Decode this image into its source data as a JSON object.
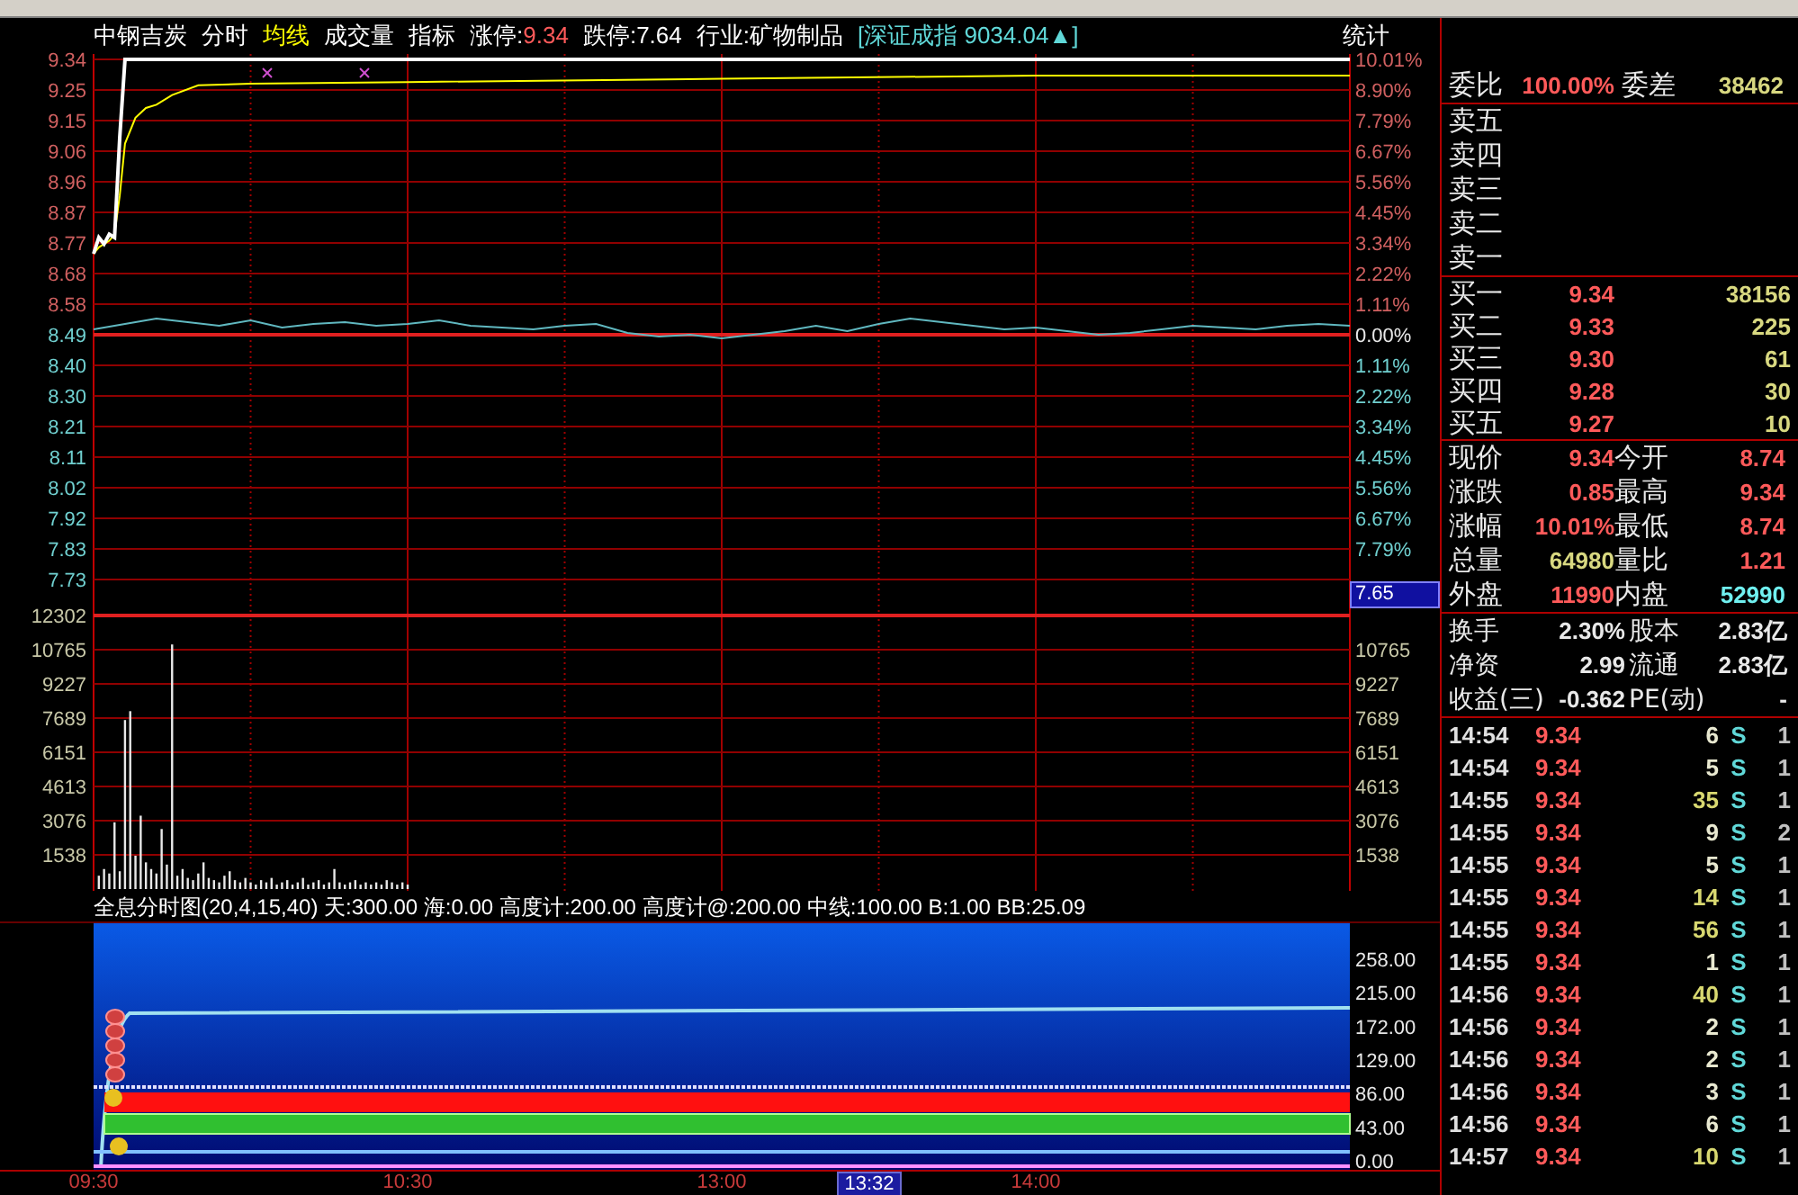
{
  "header": {
    "stock": "中钢吉炭",
    "items": [
      {
        "label": "分时",
        "color": "#ffffff"
      },
      {
        "label": "均线",
        "color": "#ffff00"
      },
      {
        "label": "成交量",
        "color": "#ffffff"
      },
      {
        "label": "指标",
        "color": "#ffffff"
      }
    ],
    "limit_up": {
      "label": "涨停:",
      "value": "9.34"
    },
    "limit_down": {
      "label": "跌停:",
      "value": "7.64"
    },
    "industry": "行业:矿物制品",
    "index": "[深证成指 9034.04▲]",
    "stats": "统计"
  },
  "price_chart": {
    "axis_labels": [
      "9.34",
      "9.25",
      "9.15",
      "9.06",
      "8.96",
      "8.87",
      "8.77",
      "8.68",
      "8.58",
      "8.49",
      "8.40",
      "8.30",
      "8.21",
      "8.11",
      "8.02",
      "7.92",
      "7.83",
      "7.73"
    ],
    "percent_labels": [
      "10.01%",
      "8.90%",
      "7.79%",
      "6.67%",
      "5.56%",
      "4.45%",
      "3.34%",
      "2.22%",
      "1.11%",
      "0.00%",
      "1.11%",
      "2.22%",
      "3.34%",
      "4.45%",
      "5.56%",
      "6.67%",
      "7.79%"
    ]
  },
  "volume_chart": {
    "axis_labels": [
      "12302",
      "10765",
      "9227",
      "7689",
      "6151",
      "4613",
      "3076",
      "1538"
    ],
    "right_labels": [
      "10765",
      "9227",
      "7689",
      "6151",
      "4613",
      "3076",
      "1538"
    ]
  },
  "time_axis": [
    "09:30",
    "10:30",
    "13:00",
    "14:00"
  ],
  "cursor": {
    "price": "7.65",
    "time": "13:32"
  },
  "indicator": {
    "title": "全息分时图(20,4,15,40) 天:300.00 海:0.00 高度计:200.00 高度计@:200.00 中线:100.00 B:1.00 BB:25.09",
    "axis_labels": [
      "258.00",
      "215.00",
      "172.00",
      "129.00",
      "86.00",
      "43.00",
      "0.00"
    ]
  },
  "order_ratio": {
    "label": "委比",
    "value": "100.00%",
    "diff_label": "委差",
    "diff_value": "38462"
  },
  "asks": [
    {
      "label": "卖五"
    },
    {
      "label": "卖四"
    },
    {
      "label": "卖三"
    },
    {
      "label": "卖二"
    },
    {
      "label": "卖一"
    }
  ],
  "bids": [
    {
      "label": "买一",
      "price": "9.34",
      "volume": "38156"
    },
    {
      "label": "买二",
      "price": "9.33",
      "volume": "225"
    },
    {
      "label": "买三",
      "price": "9.30",
      "volume": "61"
    },
    {
      "label": "买四",
      "price": "9.28",
      "volume": "30"
    },
    {
      "label": "买五",
      "price": "9.27",
      "volume": "10"
    }
  ],
  "quote": [
    {
      "label": "现价",
      "value": "9.34",
      "color": "#ff5a5a"
    },
    {
      "label": "今开",
      "value": "8.74",
      "color": "#ff5a5a"
    },
    {
      "label": "涨跌",
      "value": "0.85",
      "color": "#ff5a5a"
    },
    {
      "label": "最高",
      "value": "9.34",
      "color": "#ff5a5a"
    },
    {
      "label": "涨幅",
      "value": "10.01%",
      "color": "#ff5a5a"
    },
    {
      "label": "最低",
      "value": "8.74",
      "color": "#ff5a5a"
    },
    {
      "label": "总量",
      "value": "64980",
      "color": "#d8d880"
    },
    {
      "label": "量比",
      "value": "1.21",
      "color": "#ff5a5a"
    },
    {
      "label": "外盘",
      "value": "11990",
      "color": "#ff5a5a"
    },
    {
      "label": "内盘",
      "value": "52990",
      "color": "#70f0f0"
    }
  ],
  "fundamentals": [
    {
      "label": "换手",
      "value": "2.30%"
    },
    {
      "label": "股本",
      "value": "2.83亿"
    },
    {
      "label": "净资",
      "value": "2.99"
    },
    {
      "label": "流通",
      "value": "2.83亿"
    },
    {
      "label": "收益(三)",
      "value": "-0.362"
    },
    {
      "label": "PE(动)",
      "value": "-"
    }
  ],
  "trades": [
    {
      "time": "14:54",
      "price": "9.34",
      "volume": "6",
      "side": "S",
      "count": "1",
      "color": "#e8e8d0"
    },
    {
      "time": "14:54",
      "price": "9.34",
      "volume": "5",
      "side": "S",
      "count": "1",
      "color": "#e8e8d0"
    },
    {
      "time": "14:55",
      "price": "9.34",
      "volume": "35",
      "side": "S",
      "count": "1",
      "color": "#d8d870"
    },
    {
      "time": "14:55",
      "price": "9.34",
      "volume": "9",
      "side": "S",
      "count": "2",
      "color": "#e8e8d0"
    },
    {
      "time": "14:55",
      "price": "9.34",
      "volume": "5",
      "side": "S",
      "count": "1",
      "color": "#e8e8d0"
    },
    {
      "time": "14:55",
      "price": "9.34",
      "volume": "14",
      "side": "S",
      "count": "1",
      "color": "#d8d870"
    },
    {
      "time": "14:55",
      "price": "9.34",
      "volume": "56",
      "side": "S",
      "count": "1",
      "color": "#d8d870"
    },
    {
      "time": "14:55",
      "price": "9.34",
      "volume": "1",
      "side": "S",
      "count": "1",
      "color": "#e8e8d0"
    },
    {
      "time": "14:56",
      "price": "9.34",
      "volume": "40",
      "side": "S",
      "count": "1",
      "color": "#d8d870"
    },
    {
      "time": "14:56",
      "price": "9.34",
      "volume": "2",
      "side": "S",
      "count": "1",
      "color": "#e8e8d0"
    },
    {
      "time": "14:56",
      "price": "9.34",
      "volume": "2",
      "side": "S",
      "count": "1",
      "color": "#e8e8d0"
    },
    {
      "time": "14:56",
      "price": "9.34",
      "volume": "3",
      "side": "S",
      "count": "1",
      "color": "#e8e8d0"
    },
    {
      "time": "14:56",
      "price": "9.34",
      "volume": "6",
      "side": "S",
      "count": "1",
      "color": "#e8e8d0"
    },
    {
      "time": "14:57",
      "price": "9.34",
      "volume": "10",
      "side": "S",
      "count": "1",
      "color": "#d8d870"
    }
  ]
}
